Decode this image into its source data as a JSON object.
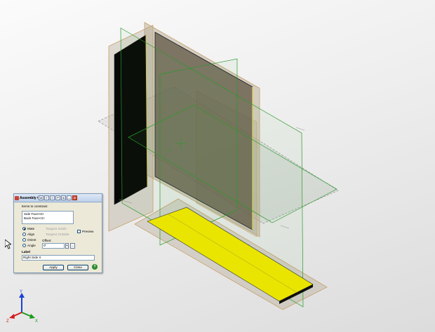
{
  "dialog": {
    "title": "Assembly Co...",
    "toolbar": [
      "M",
      "≡",
      "≡",
      "↶",
      "≪",
      "—",
      "✕"
    ],
    "items_label": "Items to constrain:",
    "items": [
      "Side Face<6>",
      "Back Face<3>"
    ],
    "options": [
      {
        "label": "Mate",
        "selected": true
      },
      {
        "label": "Align",
        "selected": false
      },
      {
        "label": "Orient",
        "selected": false
      },
      {
        "label": "Angle",
        "selected": false
      }
    ],
    "tangent_inside": "Tangent Inside",
    "tangent_outside": "Tangent Outside",
    "preview_label": "Preview",
    "offset_label": "Offset:",
    "offset_value": "0\"",
    "label_heading": "Label",
    "label_value": "Right Side X",
    "apply_label": "Apply",
    "close_label": "Close",
    "help_symbol": "?"
  },
  "triad": {
    "x_label": "X",
    "y_label": "Y",
    "z_label": "Z",
    "x_color": "#1a9b1a",
    "y_color": "#1b3fd6",
    "z_color": "#d41a1a"
  },
  "colors": {
    "plane_tan": "#b8ab95",
    "plane_green": "#2b9a2b",
    "board_yellow": "#e9e500",
    "board_black": "#101010"
  }
}
